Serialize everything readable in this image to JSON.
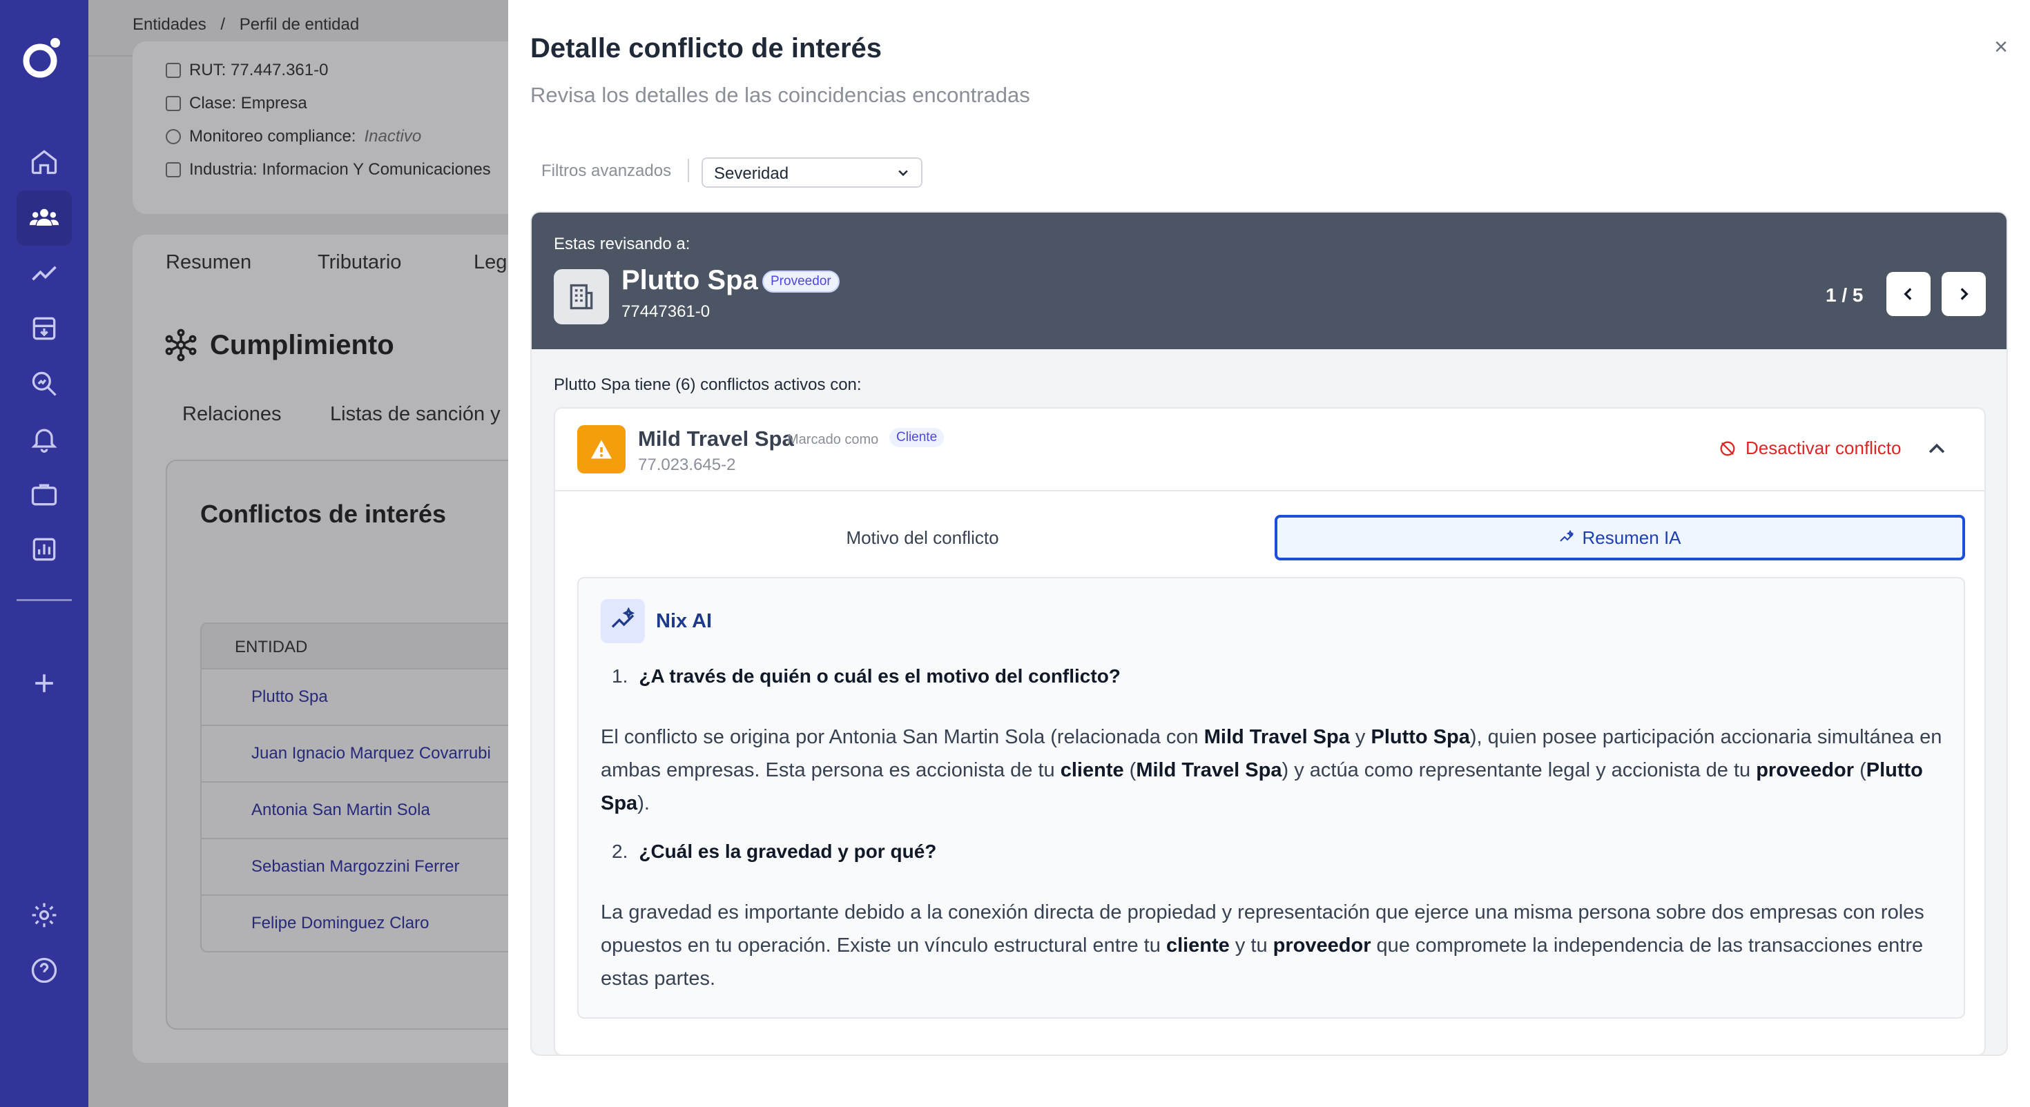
{
  "breadcrumb": {
    "items": [
      "Entidades",
      "/",
      "Perfil de entidad"
    ]
  },
  "entity_info": {
    "rut": "RUT: 77.447.361-0",
    "clase": "Clase: Empresa",
    "monitoreo_label": "Monitoreo compliance:",
    "monitoreo_value": "Inactivo",
    "industria": "Industria: Informacion Y Comunicaciones"
  },
  "profile_tabs": [
    "Resumen",
    "Tributario",
    "Leg"
  ],
  "compliance": {
    "title": "Cumplimiento",
    "subtabs": [
      "Relaciones",
      "Listas de sanción y"
    ],
    "conflicts_title": "Conflictos de interés",
    "table_header": "ENTIDAD",
    "rows": [
      "Plutto Spa",
      "Juan Ignacio Marquez Covarrubi",
      "Antonia San Martin Sola",
      "Sebastian Margozzini Ferrer",
      "Felipe Dominguez Claro"
    ]
  },
  "drawer": {
    "title": "Detalle conflicto de interés",
    "subtitle": "Revisa los detalles de las coincidencias encontradas",
    "close": "×",
    "filter_label": "Filtros avanzados",
    "filter_value": "Severidad"
  },
  "review": {
    "label": "Estas revisando a:",
    "name": "Plutto Spa",
    "badge": "Proveedor",
    "rut": "77447361-0",
    "pager": "1 / 5"
  },
  "conflicts": {
    "summary": "Plutto Spa tiene (6) conflictos activos con:",
    "card": {
      "name": "Mild Travel Spa",
      "marked": "Marcado como",
      "badge": "Cliente",
      "rut": "77.023.645-2",
      "deactivate": "Desactivar conflicto"
    },
    "tabs": {
      "motivo": "Motivo del conflicto",
      "resumen": "Resumen IA"
    },
    "ai": {
      "name": "Nix AI",
      "q1_num": "1.",
      "q1": "¿A través de quién o cuál es el motivo del conflicto?",
      "a1": [
        "El conflicto se origina por Antonia San Martin Sola (relacionada con ",
        "Mild Travel Spa",
        " y ",
        "Plutto Spa",
        "), quien posee participación accionaria simultánea en ambas empresas. Esta persona es accionista de tu ",
        "cliente",
        " (",
        "Mild Travel Spa",
        ") y actúa como representante legal y accionista de tu ",
        "proveedor",
        " (",
        "Plutto Spa",
        ")."
      ],
      "q2_num": "2.",
      "q2": "¿Cuál es la gravedad y por qué?",
      "a2": [
        "La gravedad es importante debido a la conexión directa de propiedad y representación que ejerce una misma persona sobre dos empresas con roles opuestos en tu operación. Existe un vínculo estructural entre tu ",
        "cliente",
        " y tu ",
        "proveedor",
        " que compromete la independencia de las transacciones entre estas partes."
      ]
    }
  },
  "colors": {
    "sidebar": "#32349a",
    "accent": "#1d4ed8",
    "warning": "#f59e0b",
    "danger": "#dc2626"
  }
}
